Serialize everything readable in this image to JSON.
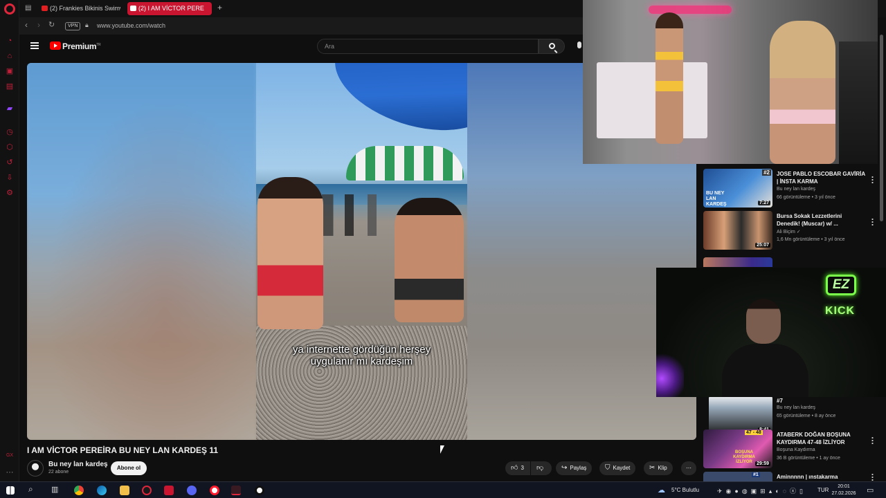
{
  "browser": {
    "tabs": [
      {
        "label": "(2) Frankies Bikinis Swimw",
        "active": false
      },
      {
        "label": "(2) I AM VİCTOR PERE",
        "active": true
      }
    ],
    "new_tab_symbol": "+",
    "vpn_badge": "VPN",
    "url": "www.youtube.com/watch"
  },
  "youtube": {
    "logo_text": "Premium",
    "logo_region": "TR",
    "search_placeholder": "Ara"
  },
  "video": {
    "subtitle_line1": "ya internette gördüğün herşey",
    "subtitle_line2": "uygulanır mı kardeşim",
    "title": "I AM VİCTOR PEREİRA BU NEY LAN KARDEŞ 11",
    "channel_name": "Bu ney lan kardeş",
    "channel_subs": "22 abone",
    "subscribe_label": "Abone ol",
    "like_count": "3",
    "share_label": "Paylaş",
    "save_label": "Kaydet",
    "clip_label": "Klip"
  },
  "related": [
    {
      "title": "JOSE PABLO ESCOBAR GAVİRİA | İNSTA KARMA",
      "channel": "Bu ney lan kardeş",
      "meta": "66 görüntüleme • 3 yıl önce",
      "duration": "7:27",
      "badge": "#2",
      "thumb_text": "BU NEY LAN KARDEŞ"
    },
    {
      "title": "Bursa Sokak Lezzetlerini Denedik! (Muscar) w/ ...",
      "channel": "Ali Biçim",
      "meta": "1,6 Mn görüntüleme • 3 yıl önce",
      "duration": "25:07"
    },
    {
      "title": "#7",
      "channel": "Bu ney lan kardeş",
      "meta": "65 görüntüleme • 8 ay önce",
      "duration": "8:41"
    },
    {
      "title": "ATABERK DOĞAN BOŞUNA KAYDIRMA 47-48 İZLİYOR",
      "channel": "Boşuna Kaydırma",
      "meta": "36 B görüntüleme • 1 ay önce",
      "duration": "29:59",
      "badge": "47 - 48",
      "thumb_text": "BOŞUNA KAYDIRMA İZLİYOR"
    },
    {
      "title": "Aminnnnn | ınstakarma",
      "badge": "#1"
    }
  ],
  "overlay": {
    "ez_logo": "EZ",
    "kick_text": "KICK"
  },
  "taskbar": {
    "weather": "5°C  Bulutlu",
    "lang": "TUR",
    "time": "20:01",
    "date": "27.02.2026"
  },
  "colors": {
    "opera_red": "#e0263b",
    "active_tab": "#c9152f",
    "youtube_red": "#ff0000",
    "kick_green": "#7cff4a"
  },
  "icons": [
    "opera-logo-icon",
    "search-icon",
    "mic-icon",
    "like-icon",
    "dislike-icon",
    "share-icon",
    "bookmark-icon",
    "scissors-icon",
    "more-icon"
  ]
}
